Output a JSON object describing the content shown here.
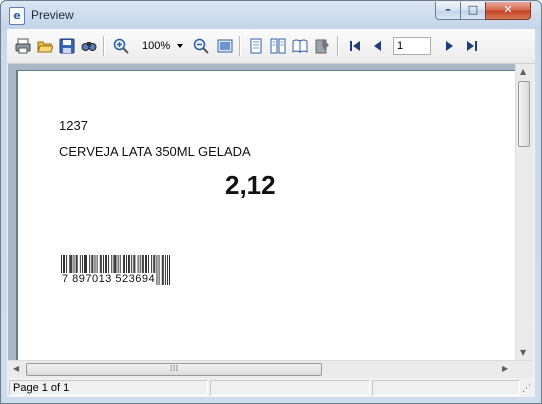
{
  "window": {
    "title": "Preview",
    "app_icon_glyph": "e"
  },
  "titlebar_buttons": {
    "minimize": "–",
    "maximize": "□",
    "close": "✕"
  },
  "toolbar": {
    "zoom_value": "100%",
    "page_number": "1",
    "icons": [
      "print-icon",
      "open-icon",
      "save-icon",
      "find-icon",
      "zoom-in-icon",
      "zoom-out-icon",
      "fit-page-icon",
      "single-page-icon",
      "two-pages-icon",
      "book-icon",
      "page-setup-icon",
      "first-page-icon",
      "previous-page-icon",
      "next-page-icon",
      "last-page-icon"
    ]
  },
  "document": {
    "product_code": "1237",
    "description": "CERVEJA LATA 350ML GELADA",
    "price": "2,12",
    "barcode_digits": "7 897013 523694"
  },
  "statusbar": {
    "page_info": "Page 1 of 1",
    "cell2": "",
    "cell3": ""
  },
  "colors": {
    "title_bg": "#c9d9ec",
    "close_red": "#c3401f",
    "page_bg": "#ffffff",
    "workspace": "#aab8c6"
  }
}
